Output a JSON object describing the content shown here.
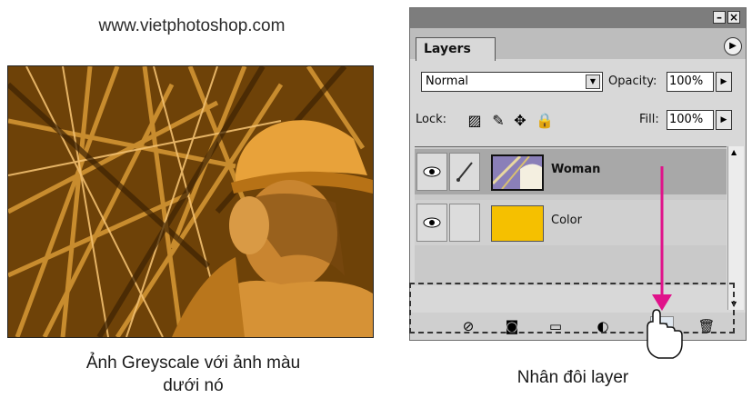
{
  "site_url": "www.vietphotoshop.com",
  "caption_left_line1": "Ảnh Greyscale với ảnh màu",
  "caption_left_line2": "dưới nó",
  "caption_right": "Nhân đôi layer",
  "panel": {
    "tab_label": "Layers",
    "blend_mode": "Normal",
    "opacity_label": "Opacity:",
    "opacity_value": "100%",
    "lock_label": "Lock:",
    "fill_label": "Fill:",
    "fill_value": "100%",
    "layers": [
      {
        "name": "Woman",
        "selected": true
      },
      {
        "name": "Color",
        "selected": false
      }
    ]
  },
  "colors": {
    "photo_tone": "#c8821a",
    "color_layer": "#f5c000",
    "arrow": "#e0128a"
  }
}
